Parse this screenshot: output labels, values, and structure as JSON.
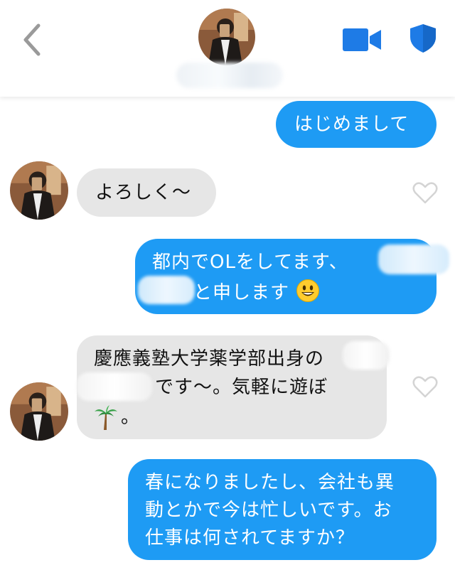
{
  "header": {
    "back_icon": "chevron-left-icon",
    "video_icon": "video-camera-icon",
    "safety_icon": "shield-icon",
    "accent_color": "#1e7be6"
  },
  "messages": [
    {
      "direction": "outgoing",
      "text": "はじめまして"
    },
    {
      "direction": "incoming",
      "text": "よろしく〜",
      "like_icon": "heart-outline-icon"
    },
    {
      "direction": "outgoing",
      "line1": "都内でOLをしてます、",
      "line2": "と申します",
      "emoji": "smiling-face-emoji"
    },
    {
      "direction": "incoming",
      "line1": "慶應義塾大学薬学部出身の",
      "line2": "です〜。気軽に遊ぼ",
      "line3": "。",
      "emoji": "palm-tree-emoji",
      "like_icon": "heart-outline-icon"
    },
    {
      "direction": "outgoing",
      "line1": "春になりましたし、会社も異",
      "line2": "動とかで今は忙しいです。お",
      "line3": "仕事は何されてますか？"
    }
  ],
  "colors": {
    "outgoing_bubble": "#1e9bf4",
    "incoming_bubble": "#e6e6e6"
  }
}
